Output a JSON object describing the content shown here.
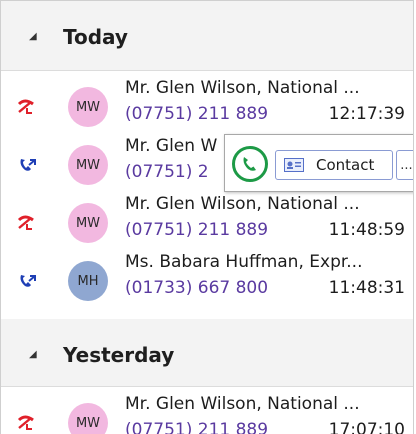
{
  "groups": [
    {
      "title": "Today",
      "expand_glyph": "◢"
    },
    {
      "title": "Yesterday",
      "expand_glyph": "◢"
    }
  ],
  "calls": [
    {
      "type": "missed",
      "initials": "MW",
      "avatar_color": "#f2b8e0",
      "name": "Mr. Glen Wilson, National ...",
      "number": "(07751) 211 889",
      "time": "12:17:39"
    },
    {
      "type": "outgoing",
      "initials": "MW",
      "avatar_color": "#f2b8e0",
      "name": "Mr. Glen W",
      "number": "(07751) 2",
      "time": ""
    },
    {
      "type": "missed",
      "initials": "MW",
      "avatar_color": "#f2b8e0",
      "name": "Mr. Glen Wilson, National ...",
      "number": "(07751) 211 889",
      "time": "11:48:59"
    },
    {
      "type": "outgoing",
      "initials": "MH",
      "avatar_color": "#8fa7d1",
      "name": "Ms. Babara Huffman, Expr...",
      "number": "(01733) 667 800",
      "time": "11:48:31"
    },
    {
      "type": "missed",
      "initials": "MW",
      "avatar_color": "#f2b8e0",
      "name": "Mr. Glen Wilson, National ...",
      "number": "(07751) 211 889",
      "time": "17:07:10"
    }
  ],
  "popup": {
    "call_icon": "phone-icon",
    "contact_label": "Contact",
    "contact_icon": "contact-card-icon",
    "more_label": "..."
  },
  "colors": {
    "missed": "#e0202a",
    "outgoing": "#1f3fb5",
    "call_green": "#1d9a46"
  }
}
